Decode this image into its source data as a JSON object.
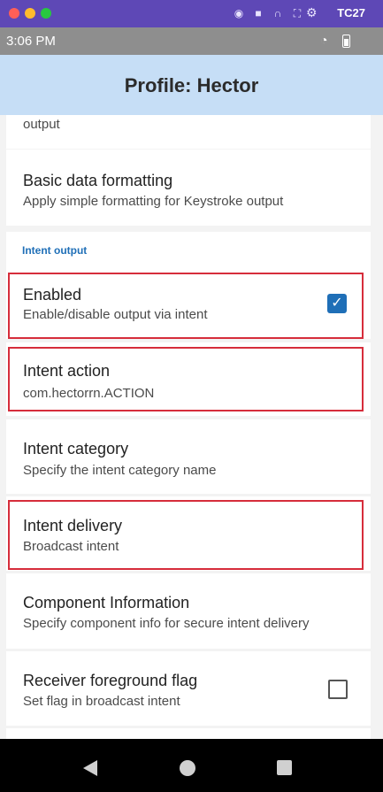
{
  "device": {
    "name": "TC27",
    "window_buttons": [
      "close",
      "minimize",
      "zoom"
    ],
    "top_icons": [
      "camera-icon",
      "video-icon",
      "headset-icon",
      "fullscreen-icon",
      "settings-icon"
    ]
  },
  "status": {
    "time": "3:06 PM",
    "icons": [
      "wifi-icon",
      "battery-icon"
    ]
  },
  "appbar": {
    "title": "Profile: Hector"
  },
  "sections": {
    "partial_output": "output",
    "basic_formatting": {
      "title": "Basic data formatting",
      "subtitle": "Apply simple formatting for Keystroke output"
    },
    "intent_output_header": "Intent output",
    "enabled": {
      "title": "Enabled",
      "subtitle": "Enable/disable output via intent",
      "checked": true
    },
    "intent_action": {
      "title": "Intent action",
      "subtitle": "com.hectorrn.ACTION"
    },
    "intent_category": {
      "title": "Intent category",
      "subtitle": "Specify the intent category name"
    },
    "intent_delivery": {
      "title": "Intent delivery",
      "subtitle": "Broadcast intent"
    },
    "component_info": {
      "title": "Component Information",
      "subtitle": "Specify component info for secure intent delivery"
    },
    "receiver_flag": {
      "title": "Receiver foreground flag",
      "subtitle": "Set flag in broadcast intent",
      "checked": false
    }
  },
  "colors": {
    "top_bar": "#5e48b6",
    "status_bar": "#8e8e8e",
    "app_bar": "#c6def6",
    "accent": "#1f6fb7",
    "highlight": "#d62d3b"
  },
  "nav": {
    "icons": [
      "back-icon",
      "home-icon",
      "recents-icon"
    ]
  }
}
